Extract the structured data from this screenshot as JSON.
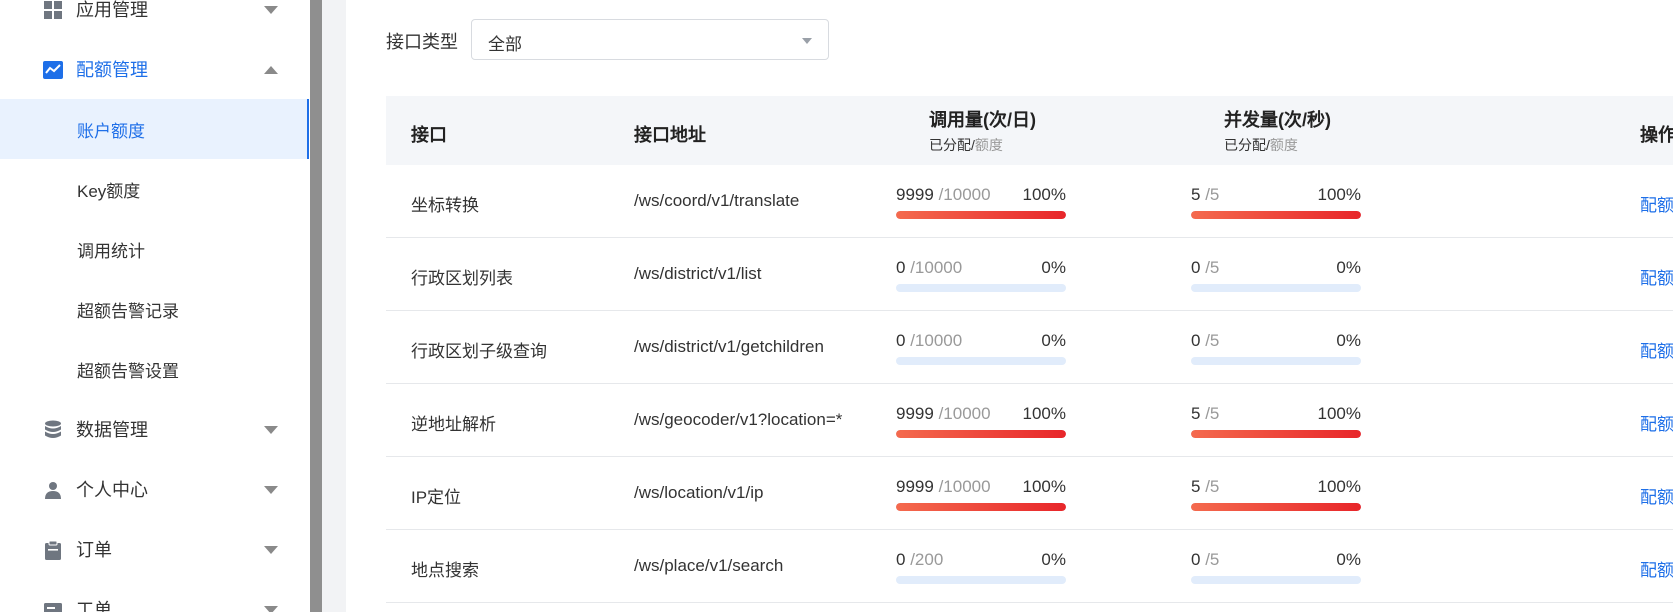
{
  "sidebar": {
    "groups": [
      {
        "label": "应用管理",
        "icon": "grid-icon"
      },
      {
        "label": "配额管理",
        "icon": "chart-line-icon"
      },
      {
        "label": "数据管理",
        "icon": "database-icon"
      },
      {
        "label": "个人中心",
        "icon": "user-icon"
      },
      {
        "label": "订单",
        "icon": "clipboard-icon"
      },
      {
        "label": "工单",
        "icon": "ticket-icon"
      }
    ],
    "sub_items": [
      {
        "label": "账户额度"
      },
      {
        "label": "Key额度"
      },
      {
        "label": "调用统计"
      },
      {
        "label": "超额告警记录"
      },
      {
        "label": "超额告警设置"
      }
    ]
  },
  "filter": {
    "label": "接口类型",
    "selected": "全部"
  },
  "table": {
    "headers": {
      "api": "接口",
      "address": "接口地址",
      "calls": "调用量(次/日)",
      "calls_sub_a": "已分配/",
      "calls_sub_b": "额度",
      "concurrency": "并发量(次/秒)",
      "conc_sub_a": "已分配/",
      "conc_sub_b": "额度",
      "action": "操作"
    },
    "rows": [
      {
        "name": "坐标转换",
        "address": "/ws/coord/v1/translate",
        "calls_used": "9999",
        "calls_quota": "/10000",
        "calls_pct": "100%",
        "calls_fill": 100,
        "conc_used": "5",
        "conc_quota": "/5",
        "conc_pct": "100%",
        "conc_fill": 100,
        "action": "配额"
      },
      {
        "name": "行政区划列表",
        "address": "/ws/district/v1/list",
        "calls_used": "0",
        "calls_quota": "/10000",
        "calls_pct": "0%",
        "calls_fill": 0,
        "conc_used": "0",
        "conc_quota": "/5",
        "conc_pct": "0%",
        "conc_fill": 0,
        "action": "配额"
      },
      {
        "name": "行政区划子级查询",
        "address": "/ws/district/v1/getchildren",
        "calls_used": "0",
        "calls_quota": "/10000",
        "calls_pct": "0%",
        "calls_fill": 0,
        "conc_used": "0",
        "conc_quota": "/5",
        "conc_pct": "0%",
        "conc_fill": 0,
        "action": "配额"
      },
      {
        "name": "逆地址解析",
        "address": "/ws/geocoder/v1?location=*",
        "calls_used": "9999",
        "calls_quota": "/10000",
        "calls_pct": "100%",
        "calls_fill": 100,
        "conc_used": "5",
        "conc_quota": "/5",
        "conc_pct": "100%",
        "conc_fill": 100,
        "action": "配额"
      },
      {
        "name": "IP定位",
        "address": "/ws/location/v1/ip",
        "calls_used": "9999",
        "calls_quota": "/10000",
        "calls_pct": "100%",
        "calls_fill": 100,
        "conc_used": "5",
        "conc_quota": "/5",
        "conc_pct": "100%",
        "conc_fill": 100,
        "action": "配额"
      },
      {
        "name": "地点搜索",
        "address": "/ws/place/v1/search",
        "calls_used": "0",
        "calls_quota": "/200",
        "calls_pct": "0%",
        "calls_fill": 0,
        "conc_used": "0",
        "conc_quota": "/5",
        "conc_pct": "0%",
        "conc_fill": 0,
        "action": "配额"
      }
    ]
  },
  "colors": {
    "accent": "#1e6fe8",
    "bar_fill": "#e8262a",
    "bar_track": "#e1ecfb"
  }
}
